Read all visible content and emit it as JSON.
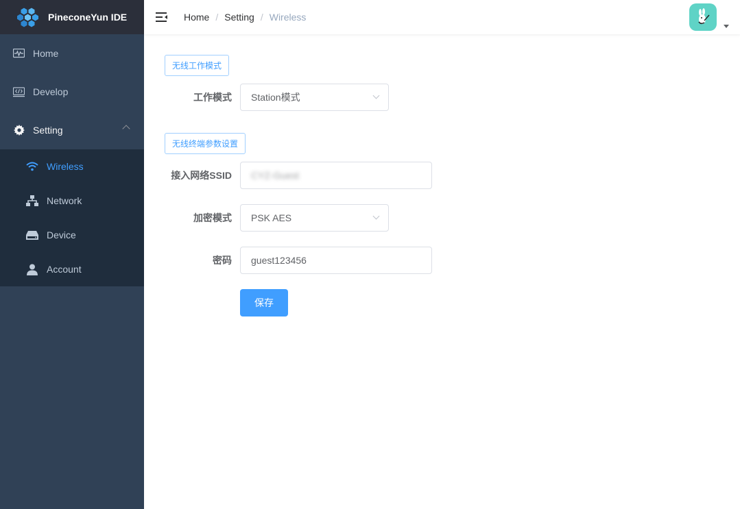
{
  "app": {
    "title": "PineconeYun IDE"
  },
  "sidebar": {
    "items": [
      {
        "label": "Home",
        "icon": "monitor-icon"
      },
      {
        "label": "Develop",
        "icon": "code-icon"
      },
      {
        "label": "Setting",
        "icon": "gear-icon",
        "expanded": true
      }
    ],
    "sub_items": [
      {
        "label": "Wireless",
        "icon": "wifi-icon",
        "active": true
      },
      {
        "label": "Network",
        "icon": "network-icon"
      },
      {
        "label": "Device",
        "icon": "device-icon"
      },
      {
        "label": "Account",
        "icon": "user-icon"
      }
    ]
  },
  "breadcrumb": {
    "items": [
      "Home",
      "Setting"
    ],
    "current": "Wireless",
    "separator": "/"
  },
  "form": {
    "section1_tag": "无线工作模式",
    "work_mode_label": "工作模式",
    "work_mode_value": "Station模式",
    "section2_tag": "无线终端参数设置",
    "ssid_label": "接入网络SSID",
    "ssid_value": "CYZ-Guest",
    "encrypt_label": "加密模式",
    "encrypt_value": "PSK AES",
    "password_label": "密码",
    "password_value": "guest123456",
    "save_label": "保存"
  },
  "colors": {
    "sidebar_bg": "#304156",
    "submenu_bg": "#1f2d3d",
    "accent": "#409eff",
    "avatar_bg": "#5fd3c6"
  }
}
